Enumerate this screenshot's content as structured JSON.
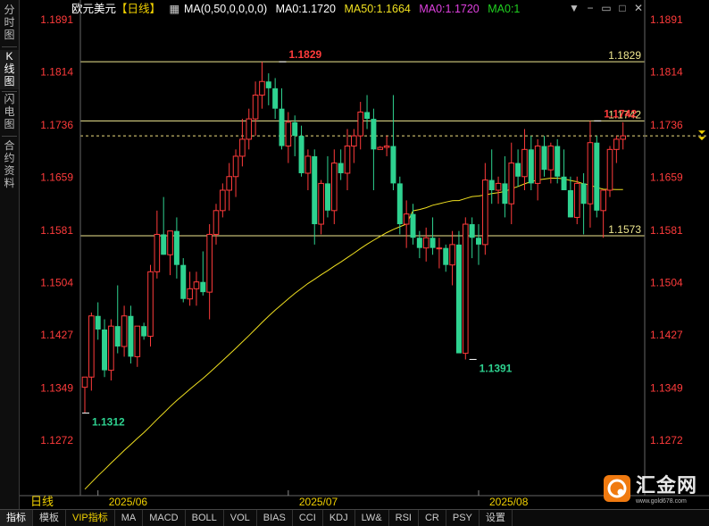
{
  "sidebar": {
    "tabs": [
      {
        "label": "分时图",
        "active": false
      },
      {
        "label": "K线图",
        "active": true
      },
      {
        "label": "闪电图",
        "active": false
      },
      {
        "label": "合约资料",
        "active": false
      }
    ]
  },
  "header": {
    "instrument": "欧元美元",
    "period": "【日线】",
    "ma_params": "MA(0,50,0,0,0,0)",
    "ma_values": [
      {
        "label": "MA0:1.1720",
        "color": "#ffffff"
      },
      {
        "label": "MA50:1.1664",
        "color": "#f0e020"
      },
      {
        "label": "MA0:1.1720",
        "color": "#e040e0"
      },
      {
        "label": "MA0:1",
        "color": "#20d020"
      }
    ],
    "window_icons": [
      "down-arrow-icon",
      "minus-icon",
      "restore-icon",
      "maximize-icon",
      "close-icon"
    ]
  },
  "corner_label": "日线",
  "watermark": {
    "brand": "汇金网",
    "url": "www.gold678.com"
  },
  "bottom_tabs": [
    {
      "label": "指标",
      "active": true,
      "vip": false
    },
    {
      "label": "模板",
      "active": false,
      "vip": false
    },
    {
      "label": "VIP指标",
      "active": false,
      "vip": true
    },
    {
      "label": "MA",
      "active": false,
      "vip": false
    },
    {
      "label": "MACD",
      "active": false,
      "vip": false
    },
    {
      "label": "BOLL",
      "active": false,
      "vip": false
    },
    {
      "label": "VOL",
      "active": false,
      "vip": false
    },
    {
      "label": "BIAS",
      "active": false,
      "vip": false
    },
    {
      "label": "CCI",
      "active": false,
      "vip": false
    },
    {
      "label": "KDJ",
      "active": false,
      "vip": false
    },
    {
      "label": "LW&",
      "active": false,
      "vip": false
    },
    {
      "label": "RSI",
      "active": false,
      "vip": false
    },
    {
      "label": "CR",
      "active": false,
      "vip": false
    },
    {
      "label": "PSY",
      "active": false,
      "vip": false
    },
    {
      "label": "设置",
      "active": false,
      "vip": false
    }
  ],
  "colors": {
    "up": "#ff3b3b",
    "down": "#2ed290",
    "axis_label": "#ff3b3b",
    "ma50": "#f0e020",
    "hline": "#f0e080",
    "date": "#f0d000"
  },
  "chart_data": {
    "type": "candlestick",
    "y_ticks": [
      "1.1891",
      "1.1814",
      "1.1736",
      "1.1659",
      "1.1581",
      "1.1504",
      "1.1427",
      "1.1349",
      "1.1272"
    ],
    "ylim": [
      1.1195,
      1.192
    ],
    "x_date_labels": [
      {
        "label": "2025/06",
        "index": 2
      },
      {
        "label": "2025/07",
        "index": 31
      },
      {
        "label": "2025/08",
        "index": 60
      }
    ],
    "horizontal_lines": [
      {
        "value": 1.1829,
        "label": "1.1829",
        "style": "solid"
      },
      {
        "value": 1.1742,
        "label": "1.1742",
        "style": "solid"
      },
      {
        "value": 1.172,
        "label": "",
        "style": "dashed"
      },
      {
        "value": 1.1573,
        "label": "1.1573",
        "style": "solid"
      }
    ],
    "annotations": [
      {
        "text": "1.1829",
        "index": 30,
        "value": 1.1829,
        "kind": "high"
      },
      {
        "text": "1.1742",
        "index": 78,
        "value": 1.1742,
        "kind": "high"
      },
      {
        "text": "1.1391",
        "index": 59,
        "value": 1.1391,
        "kind": "low"
      },
      {
        "text": "1.1312",
        "index": 0,
        "value": 1.1312,
        "kind": "low"
      }
    ],
    "current_price": 1.172,
    "candles": [
      {
        "o": 1.135,
        "h": 1.1365,
        "l": 1.1312,
        "c": 1.1365
      },
      {
        "o": 1.1365,
        "h": 1.146,
        "l": 1.1345,
        "c": 1.1455
      },
      {
        "o": 1.1455,
        "h": 1.1475,
        "l": 1.142,
        "c": 1.1435
      },
      {
        "o": 1.1435,
        "h": 1.145,
        "l": 1.1365,
        "c": 1.1375
      },
      {
        "o": 1.1375,
        "h": 1.145,
        "l": 1.136,
        "c": 1.144
      },
      {
        "o": 1.144,
        "h": 1.15,
        "l": 1.14,
        "c": 1.141
      },
      {
        "o": 1.141,
        "h": 1.147,
        "l": 1.1395,
        "c": 1.1455
      },
      {
        "o": 1.1455,
        "h": 1.147,
        "l": 1.1385,
        "c": 1.1395
      },
      {
        "o": 1.1395,
        "h": 1.144,
        "l": 1.138,
        "c": 1.144
      },
      {
        "o": 1.144,
        "h": 1.1445,
        "l": 1.142,
        "c": 1.1425
      },
      {
        "o": 1.1425,
        "h": 1.153,
        "l": 1.141,
        "c": 1.152
      },
      {
        "o": 1.152,
        "h": 1.161,
        "l": 1.151,
        "c": 1.1575
      },
      {
        "o": 1.1575,
        "h": 1.163,
        "l": 1.1545,
        "c": 1.1545
      },
      {
        "o": 1.1545,
        "h": 1.158,
        "l": 1.1515,
        "c": 1.158
      },
      {
        "o": 1.158,
        "h": 1.16,
        "l": 1.151,
        "c": 1.153
      },
      {
        "o": 1.153,
        "h": 1.154,
        "l": 1.1475,
        "c": 1.148
      },
      {
        "o": 1.148,
        "h": 1.152,
        "l": 1.147,
        "c": 1.1495
      },
      {
        "o": 1.1495,
        "h": 1.152,
        "l": 1.147,
        "c": 1.1505
      },
      {
        "o": 1.1505,
        "h": 1.155,
        "l": 1.1485,
        "c": 1.149
      },
      {
        "o": 1.149,
        "h": 1.159,
        "l": 1.145,
        "c": 1.1575
      },
      {
        "o": 1.1575,
        "h": 1.162,
        "l": 1.156,
        "c": 1.161
      },
      {
        "o": 1.161,
        "h": 1.165,
        "l": 1.16,
        "c": 1.164
      },
      {
        "o": 1.164,
        "h": 1.168,
        "l": 1.161,
        "c": 1.166
      },
      {
        "o": 1.166,
        "h": 1.17,
        "l": 1.163,
        "c": 1.169
      },
      {
        "o": 1.169,
        "h": 1.1745,
        "l": 1.1675,
        "c": 1.1715
      },
      {
        "o": 1.1715,
        "h": 1.176,
        "l": 1.17,
        "c": 1.1745
      },
      {
        "o": 1.1745,
        "h": 1.18,
        "l": 1.172,
        "c": 1.178
      },
      {
        "o": 1.178,
        "h": 1.1829,
        "l": 1.176,
        "c": 1.18
      },
      {
        "o": 1.18,
        "h": 1.1812,
        "l": 1.1765,
        "c": 1.179
      },
      {
        "o": 1.179,
        "h": 1.1805,
        "l": 1.1745,
        "c": 1.176
      },
      {
        "o": 1.176,
        "h": 1.179,
        "l": 1.17,
        "c": 1.1705
      },
      {
        "o": 1.1705,
        "h": 1.1755,
        "l": 1.168,
        "c": 1.174
      },
      {
        "o": 1.174,
        "h": 1.175,
        "l": 1.169,
        "c": 1.172
      },
      {
        "o": 1.172,
        "h": 1.1735,
        "l": 1.166,
        "c": 1.1665
      },
      {
        "o": 1.1665,
        "h": 1.17,
        "l": 1.164,
        "c": 1.169
      },
      {
        "o": 1.169,
        "h": 1.17,
        "l": 1.156,
        "c": 1.159
      },
      {
        "o": 1.159,
        "h": 1.1655,
        "l": 1.1575,
        "c": 1.165
      },
      {
        "o": 1.165,
        "h": 1.169,
        "l": 1.16,
        "c": 1.161
      },
      {
        "o": 1.161,
        "h": 1.17,
        "l": 1.159,
        "c": 1.168
      },
      {
        "o": 1.168,
        "h": 1.17,
        "l": 1.1655,
        "c": 1.1665
      },
      {
        "o": 1.1665,
        "h": 1.173,
        "l": 1.164,
        "c": 1.1705
      },
      {
        "o": 1.1705,
        "h": 1.173,
        "l": 1.168,
        "c": 1.172
      },
      {
        "o": 1.172,
        "h": 1.177,
        "l": 1.17,
        "c": 1.1755
      },
      {
        "o": 1.1755,
        "h": 1.178,
        "l": 1.173,
        "c": 1.1745
      },
      {
        "o": 1.1745,
        "h": 1.176,
        "l": 1.164,
        "c": 1.17
      },
      {
        "o": 1.17,
        "h": 1.1705,
        "l": 1.17,
        "c": 1.1703
      },
      {
        "o": 1.1703,
        "h": 1.172,
        "l": 1.169,
        "c": 1.1705
      },
      {
        "o": 1.1705,
        "h": 1.178,
        "l": 1.164,
        "c": 1.165
      },
      {
        "o": 1.165,
        "h": 1.166,
        "l": 1.1575,
        "c": 1.159
      },
      {
        "o": 1.159,
        "h": 1.1625,
        "l": 1.1555,
        "c": 1.1605
      },
      {
        "o": 1.1605,
        "h": 1.162,
        "l": 1.156,
        "c": 1.157
      },
      {
        "o": 1.157,
        "h": 1.158,
        "l": 1.154,
        "c": 1.1555
      },
      {
        "o": 1.1555,
        "h": 1.1585,
        "l": 1.1535,
        "c": 1.157
      },
      {
        "o": 1.157,
        "h": 1.16,
        "l": 1.1545,
        "c": 1.1555
      },
      {
        "o": 1.1555,
        "h": 1.157,
        "l": 1.1525,
        "c": 1.1555
      },
      {
        "o": 1.1555,
        "h": 1.156,
        "l": 1.152,
        "c": 1.153
      },
      {
        "o": 1.153,
        "h": 1.158,
        "l": 1.15,
        "c": 1.156
      },
      {
        "o": 1.156,
        "h": 1.158,
        "l": 1.147,
        "c": 1.14
      },
      {
        "o": 1.14,
        "h": 1.16,
        "l": 1.1391,
        "c": 1.159
      },
      {
        "o": 1.159,
        "h": 1.16,
        "l": 1.154,
        "c": 1.157
      },
      {
        "o": 1.157,
        "h": 1.159,
        "l": 1.153,
        "c": 1.156
      },
      {
        "o": 1.156,
        "h": 1.168,
        "l": 1.1545,
        "c": 1.1655
      },
      {
        "o": 1.1655,
        "h": 1.17,
        "l": 1.162,
        "c": 1.164
      },
      {
        "o": 1.164,
        "h": 1.166,
        "l": 1.162,
        "c": 1.165
      },
      {
        "o": 1.165,
        "h": 1.169,
        "l": 1.16,
        "c": 1.162
      },
      {
        "o": 1.162,
        "h": 1.171,
        "l": 1.159,
        "c": 1.168
      },
      {
        "o": 1.168,
        "h": 1.17,
        "l": 1.1645,
        "c": 1.166
      },
      {
        "o": 1.166,
        "h": 1.173,
        "l": 1.164,
        "c": 1.17
      },
      {
        "o": 1.17,
        "h": 1.172,
        "l": 1.164,
        "c": 1.165
      },
      {
        "o": 1.165,
        "h": 1.1715,
        "l": 1.1625,
        "c": 1.1705
      },
      {
        "o": 1.1705,
        "h": 1.172,
        "l": 1.166,
        "c": 1.167
      },
      {
        "o": 1.167,
        "h": 1.171,
        "l": 1.165,
        "c": 1.1705
      },
      {
        "o": 1.1705,
        "h": 1.1715,
        "l": 1.165,
        "c": 1.166
      },
      {
        "o": 1.166,
        "h": 1.17,
        "l": 1.164,
        "c": 1.164
      },
      {
        "o": 1.164,
        "h": 1.166,
        "l": 1.16,
        "c": 1.16
      },
      {
        "o": 1.16,
        "h": 1.166,
        "l": 1.159,
        "c": 1.165
      },
      {
        "o": 1.165,
        "h": 1.1665,
        "l": 1.1575,
        "c": 1.162
      },
      {
        "o": 1.162,
        "h": 1.1742,
        "l": 1.1585,
        "c": 1.171
      },
      {
        "o": 1.171,
        "h": 1.172,
        "l": 1.16,
        "c": 1.161
      },
      {
        "o": 1.161,
        "h": 1.164,
        "l": 1.157,
        "c": 1.164
      },
      {
        "o": 1.164,
        "h": 1.1705,
        "l": 1.163,
        "c": 1.17
      },
      {
        "o": 1.17,
        "h": 1.172,
        "l": 1.168,
        "c": 1.1715
      },
      {
        "o": 1.1715,
        "h": 1.174,
        "l": 1.17,
        "c": 1.172
      }
    ],
    "ma50": [
      null,
      1.121,
      1.1225,
      1.124,
      1.1255,
      1.127,
      1.1285,
      1.13,
      1.1315,
      1.133,
      1.1345,
      1.136,
      1.1365,
      1.137,
      1.1375,
      1.138,
      1.1385,
      1.139,
      1.1398,
      1.1405,
      1.1412,
      1.142,
      1.1428,
      1.1436,
      1.1444,
      1.1452,
      1.146,
      1.147,
      1.148,
      1.149,
      1.15,
      1.1508,
      1.1515,
      1.1522,
      1.153,
      1.1536,
      1.1542,
      1.155,
      1.1556,
      1.1562,
      1.1567,
      1.1575,
      1.1582,
      1.159,
      1.1598,
      1.1604,
      1.161,
      1.1616,
      1.1622,
      1.1628,
      1.1632,
      1.1636,
      1.164,
      1.1644,
      1.165,
      1.1655,
      1.166,
      1.1663,
      1.1664,
      1.1664
    ],
    "ma50_tail": [
      1.1578,
      1.1582,
      1.1588,
      1.1592,
      1.1596,
      1.16,
      1.1605,
      1.1608,
      1.1612,
      1.1615,
      1.1618,
      1.1622,
      1.1628,
      1.1632,
      1.1636,
      1.164,
      1.1642,
      1.1646,
      1.165,
      1.1654,
      1.1656,
      1.166,
      1.1664
    ]
  }
}
